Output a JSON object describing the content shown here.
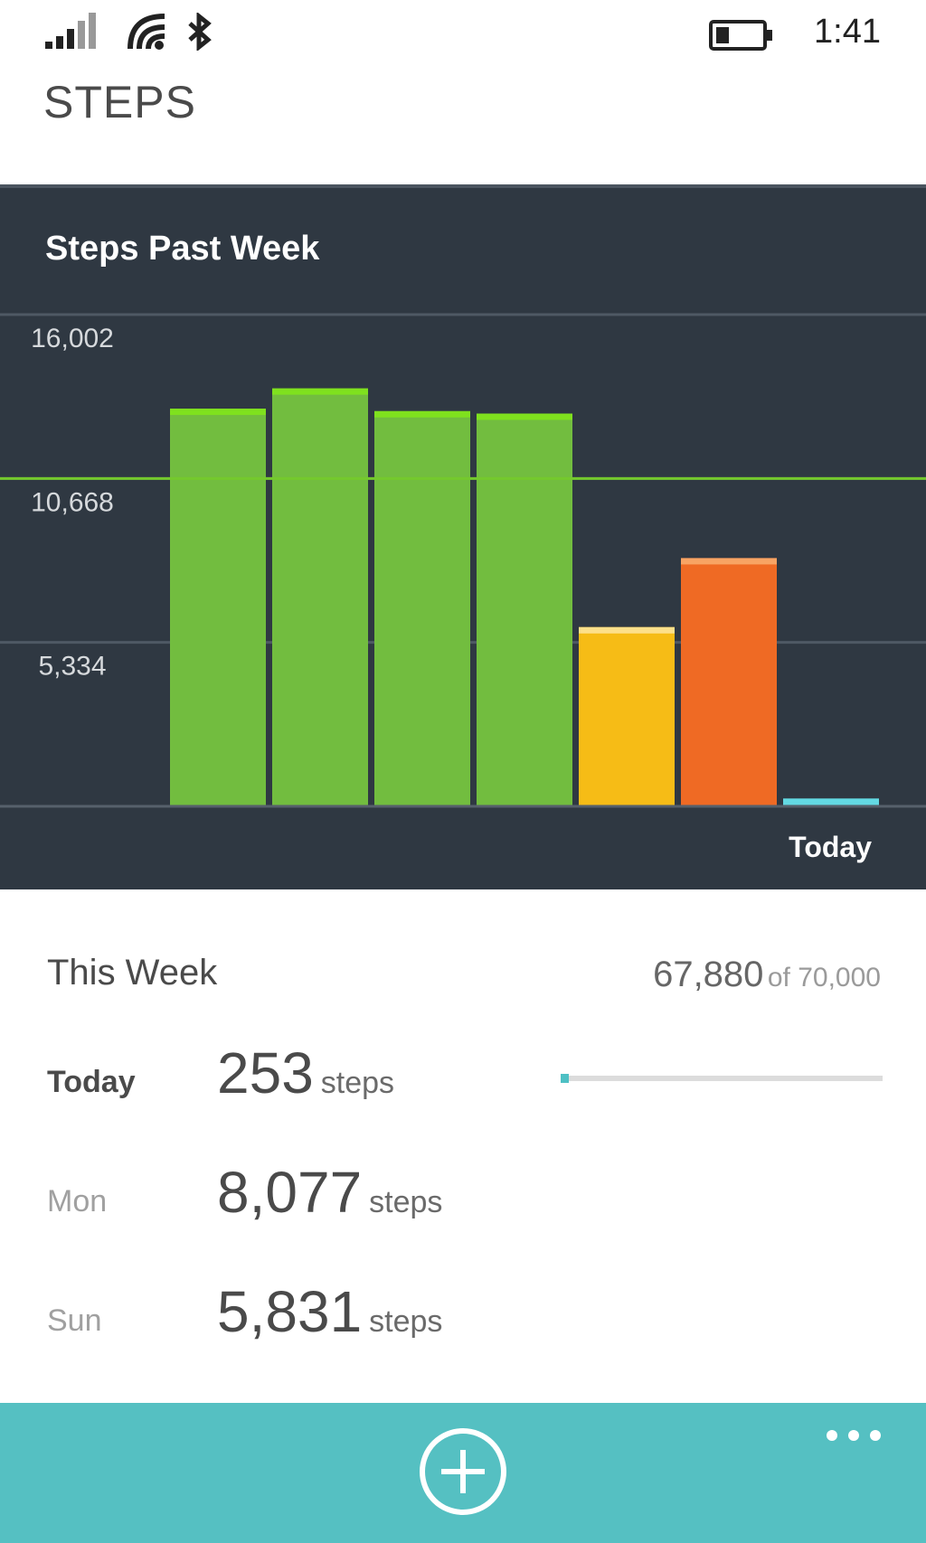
{
  "status_bar": {
    "time": "1:41",
    "icons": [
      "signal-icon",
      "wifi-icon",
      "bluetooth-icon",
      "battery-icon"
    ]
  },
  "page": {
    "title": "STEPS"
  },
  "chart_panel": {
    "title": "Steps Past Week"
  },
  "chart_data": {
    "type": "bar",
    "title": "Steps Past Week",
    "categories": [
      "",
      "",
      "",
      "",
      "",
      "",
      "Today"
    ],
    "values": [
      12940,
      13600,
      12860,
      12780,
      5831,
      8077,
      253
    ],
    "colors": [
      "#72bd3f",
      "#72bd3f",
      "#72bd3f",
      "#72bd3f",
      "#f6bc16",
      "#ef6a24",
      "#4ec0c4"
    ],
    "cap_colors": [
      "#7fe11e",
      "#7fe11e",
      "#7fe11e",
      "#7fe11e",
      "#fde08a",
      "#f8a464",
      "#63d9e3"
    ],
    "goal_line": 10668,
    "goal_color": "#74c92d",
    "y_ticks": [
      "16,002",
      "10,668",
      "5,334"
    ],
    "y_tick_values": [
      16002,
      10668,
      5334
    ],
    "ylim": [
      0,
      16002
    ],
    "xlabel": "",
    "ylabel": "",
    "grid": true
  },
  "summary": {
    "week_label": "This Week",
    "week_total": "67,880",
    "week_goal": "of 70,000",
    "days": [
      {
        "name": "Today",
        "count": "253",
        "unit": "steps",
        "bold": true
      },
      {
        "name": "Mon",
        "count": "8,077",
        "unit": "steps",
        "bold": false
      },
      {
        "name": "Sun",
        "count": "5,831",
        "unit": "steps",
        "bold": false
      }
    ],
    "today_progress": 0.025
  },
  "app_bar": {
    "add_icon": "add-circle-icon",
    "more_icon": "more-icon",
    "color": "#55c0c2"
  }
}
